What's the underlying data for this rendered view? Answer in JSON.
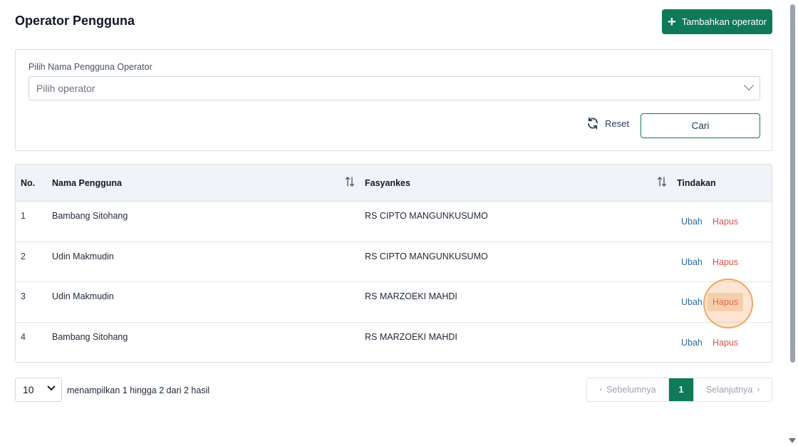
{
  "page": {
    "title": "Operator Pengguna",
    "add_button_label": "Tambahkan operator"
  },
  "filter": {
    "label": "Pilih Nama Pengguna Operator",
    "placeholder": "Pilih operator",
    "reset_label": "Reset",
    "search_label": "Cari"
  },
  "table": {
    "headers": {
      "no": "No.",
      "name": "Nama Pengguna",
      "facility": "Fasyankes",
      "actions": "Tindakan"
    },
    "rows": [
      {
        "no": "1",
        "name": "Bambang Sitohang",
        "facility": "RS CIPTO MANGUNKUSUMO",
        "edit": "Ubah",
        "delete": "Hapus"
      },
      {
        "no": "2",
        "name": "Udin Makmudin",
        "facility": "RS CIPTO MANGUNKUSUMO",
        "edit": "Ubah",
        "delete": "Hapus"
      },
      {
        "no": "3",
        "name": "Udin Makmudin",
        "facility": "RS MARZOEKI MAHDI",
        "edit": "Ubah",
        "delete": "Hapus"
      },
      {
        "no": "4",
        "name": "Bambang Sitohang",
        "facility": "RS MARZOEKI MAHDI",
        "edit": "Ubah",
        "delete": "Hapus"
      }
    ]
  },
  "pagination": {
    "per_page": "10",
    "summary": "menampilkan 1 hingga 2 dari 2 hasil",
    "prev_label": "Sebelumnya",
    "current_page": "1",
    "next_label": "Selanjutnya"
  },
  "colors": {
    "primary": "#0e7a5a",
    "danger": "#d9534f",
    "link": "#2b6aa6"
  }
}
